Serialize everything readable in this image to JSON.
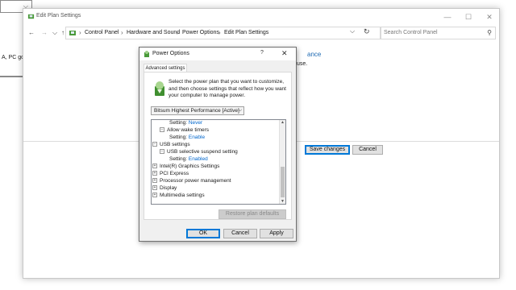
{
  "background_fragment": {
    "snippet": "A, PC goe"
  },
  "window": {
    "title": "Edit Plan Settings",
    "breadcrumbs": [
      "Control Panel",
      "Hardware and Sound",
      "Power Options",
      "Edit Plan Settings"
    ],
    "search_placeholder": "Search Control Panel",
    "heading_fragment": "ance",
    "text_fragment": "use.",
    "save_label": "Save changes",
    "cancel_label": "Cancel"
  },
  "dialog": {
    "title": "Power Options",
    "help_glyph": "?",
    "tab_label": "Advanced settings",
    "description": "Select the power plan that you want to customize, and then choose settings that reflect how you want your computer to manage power.",
    "plan_selected": "Bitsum Highest Performance [Active]",
    "tree": [
      {
        "label": "Setting:",
        "value": "Never"
      },
      {
        "toggle": "−",
        "label": "Allow wake timers"
      },
      {
        "label": "Setting:",
        "value": "Enable"
      },
      {
        "toggle": "−",
        "label": "USB settings"
      },
      {
        "toggle": "−",
        "label": "USB selective suspend setting"
      },
      {
        "label": "Setting:",
        "value": "Enabled"
      },
      {
        "toggle": "+",
        "label": "Intel(R) Graphics Settings"
      },
      {
        "toggle": "+",
        "label": "PCI Express"
      },
      {
        "toggle": "+",
        "label": "Processor power management"
      },
      {
        "toggle": "+",
        "label": "Display"
      },
      {
        "toggle": "+",
        "label": "Multimedia settings"
      }
    ],
    "restore_label": "Restore plan defaults",
    "ok_label": "OK",
    "cancel_label": "Cancel",
    "apply_label": "Apply"
  },
  "colors": {
    "link": "#0066cc",
    "accent": "#0078d7"
  }
}
